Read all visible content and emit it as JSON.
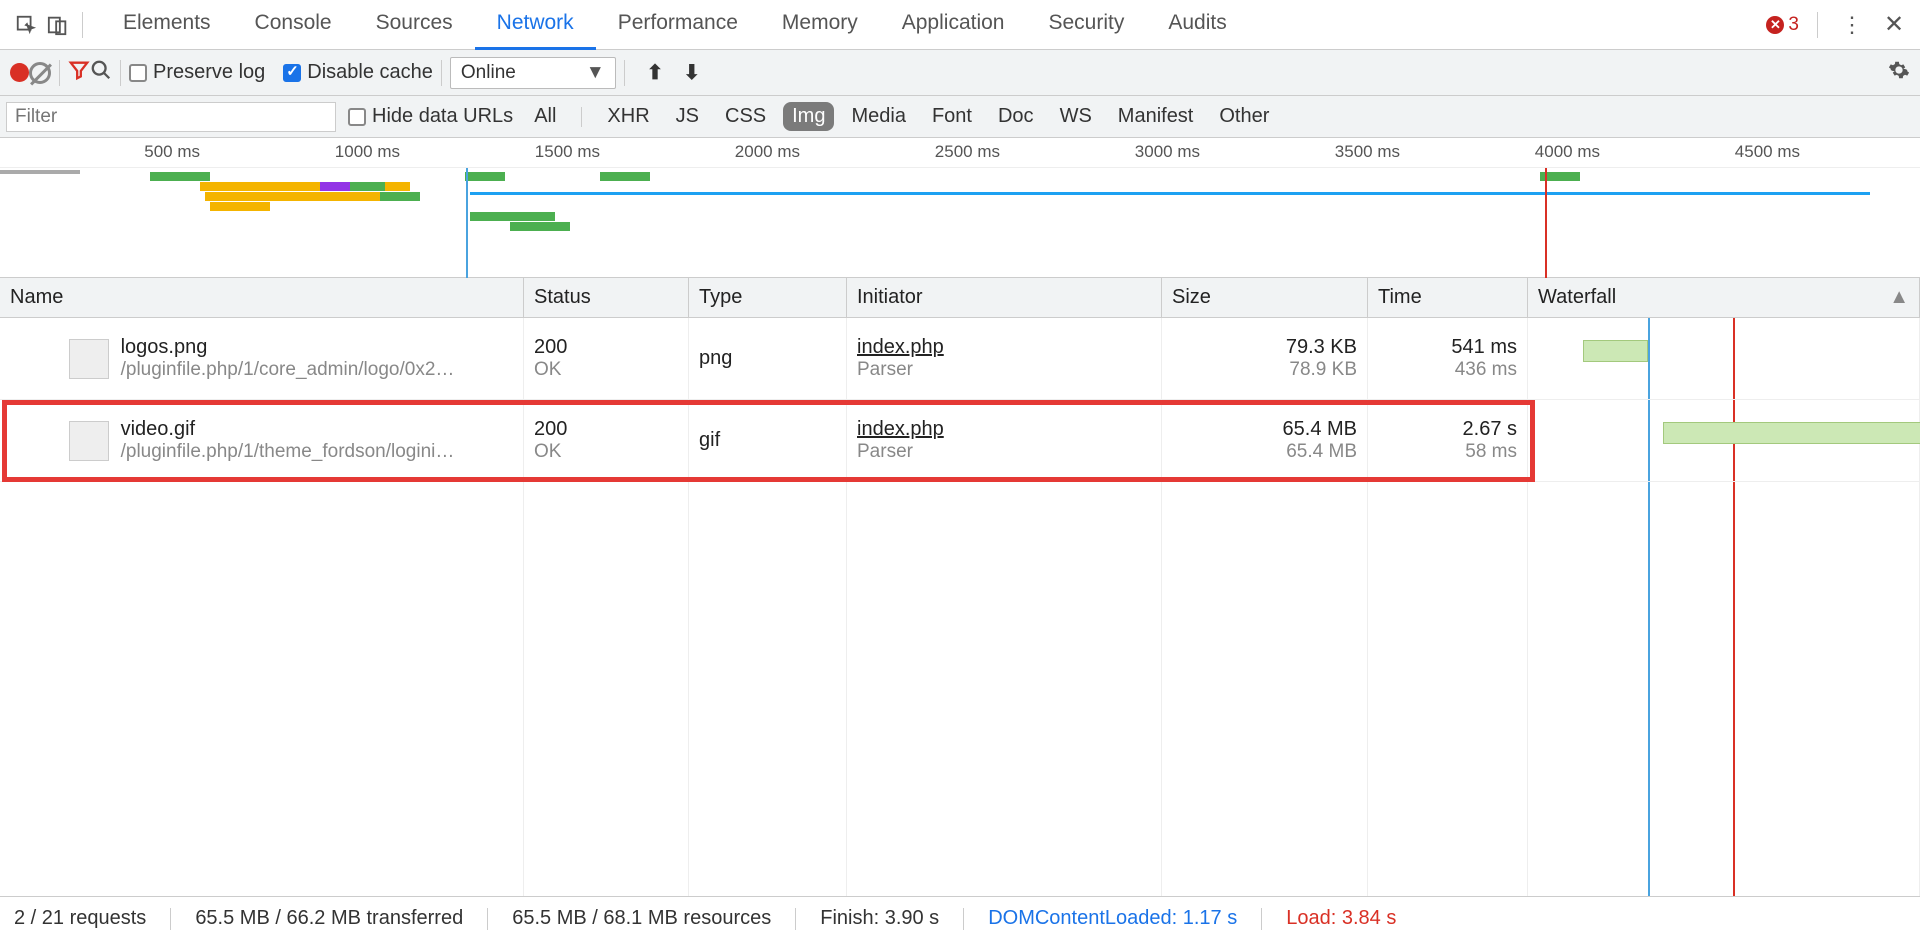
{
  "topbar": {
    "tabs": [
      "Elements",
      "Console",
      "Sources",
      "Network",
      "Performance",
      "Memory",
      "Application",
      "Security",
      "Audits"
    ],
    "active_tab": "Network",
    "error_count": "3"
  },
  "toolbar": {
    "preserve_log_label": "Preserve log",
    "disable_cache_label": "Disable cache",
    "throttle_value": "Online"
  },
  "filterbar": {
    "filter_placeholder": "Filter",
    "hide_data_urls_label": "Hide data URLs",
    "types": [
      "All",
      "XHR",
      "JS",
      "CSS",
      "Img",
      "Media",
      "Font",
      "Doc",
      "WS",
      "Manifest",
      "Other"
    ],
    "active_type": "Img"
  },
  "timeline": {
    "ticks": [
      "500 ms",
      "1000 ms",
      "1500 ms",
      "2000 ms",
      "2500 ms",
      "3000 ms",
      "3500 ms",
      "4000 ms",
      "4500 ms"
    ]
  },
  "table": {
    "headers": {
      "name": "Name",
      "status": "Status",
      "type": "Type",
      "initiator": "Initiator",
      "size": "Size",
      "time": "Time",
      "waterfall": "Waterfall"
    },
    "rows": [
      {
        "name": "logos.png",
        "path": "/pluginfile.php/1/core_admin/logo/0x2…",
        "status": "200",
        "status_text": "OK",
        "type": "png",
        "initiator": "index.php",
        "initiator_sub": "Parser",
        "size": "79.3 KB",
        "size_sub": "78.9 KB",
        "time": "541 ms",
        "time_sub": "436 ms"
      },
      {
        "name": "video.gif",
        "path": "/pluginfile.php/1/theme_fordson/logini…",
        "status": "200",
        "status_text": "OK",
        "type": "gif",
        "initiator": "index.php",
        "initiator_sub": "Parser",
        "size": "65.4 MB",
        "size_sub": "65.4 MB",
        "time": "2.67 s",
        "time_sub": "58 ms"
      }
    ]
  },
  "status": {
    "requests": "2 / 21 requests",
    "transferred": "65.5 MB / 66.2 MB transferred",
    "resources": "65.5 MB / 68.1 MB resources",
    "finish": "Finish: 3.90 s",
    "dcl": "DOMContentLoaded: 1.17 s",
    "load": "Load: 3.84 s"
  }
}
